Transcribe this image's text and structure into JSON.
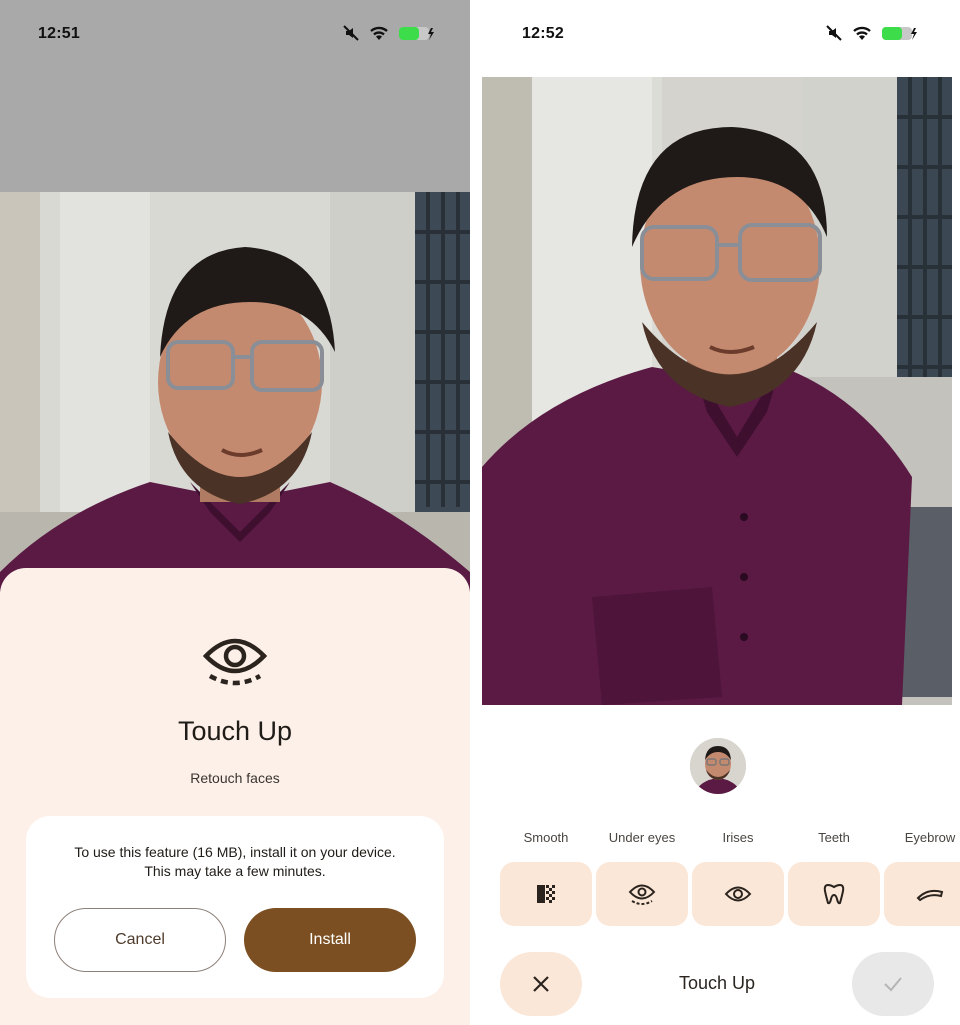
{
  "left_screen": {
    "status_bar": {
      "time": "12:51",
      "icons": [
        "mute-icon",
        "wifi-icon",
        "battery-charging-icon"
      ]
    },
    "sheet": {
      "icon": "eye-icon",
      "title": "Touch Up",
      "subtitle": "Retouch faces",
      "install_message_line1": "To use this feature (16 MB), install it on your device.",
      "install_message_line2": "This may take a few minutes.",
      "cancel_label": "Cancel",
      "install_label": "Install"
    }
  },
  "right_screen": {
    "status_bar": {
      "time": "12:52",
      "icons": [
        "mute-icon",
        "wifi-icon",
        "battery-charging-icon"
      ]
    },
    "tools": [
      {
        "label": "Smooth",
        "icon": "smooth-icon"
      },
      {
        "label": "Under eyes",
        "icon": "under-eyes-icon"
      },
      {
        "label": "Irises",
        "icon": "iris-icon"
      },
      {
        "label": "Teeth",
        "icon": "tooth-icon"
      },
      {
        "label": "Eyebrow",
        "icon": "eyebrow-icon"
      }
    ],
    "bottom_bar": {
      "title": "Touch Up",
      "close_icon": "close-icon",
      "done_icon": "check-icon"
    }
  },
  "colors": {
    "sheet_background": "#fdf0e9",
    "install_button": "#7b4f22",
    "tool_button": "#fbe7d8",
    "shirt": "#5a1a44",
    "wall": "#dcdcd6"
  }
}
